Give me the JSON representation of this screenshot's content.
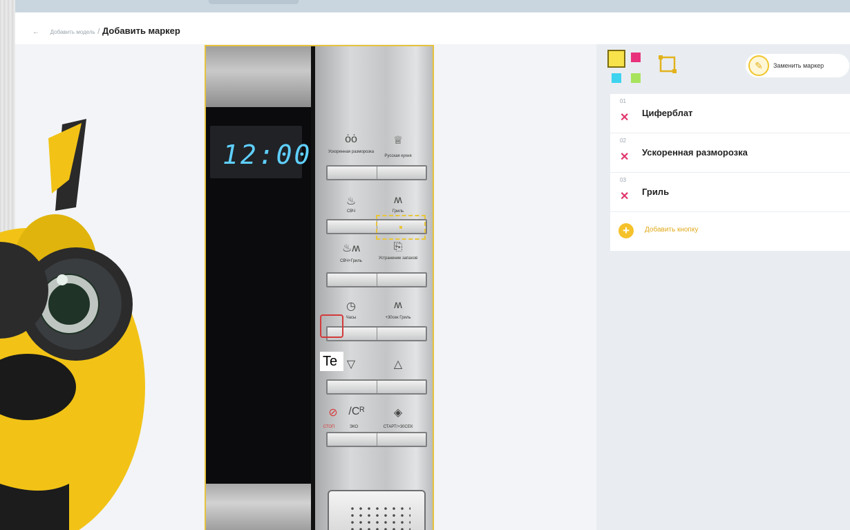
{
  "colors": {
    "accent": "#f5c22b",
    "delete": "#e0366b",
    "marker_selected": "#d33a3a"
  },
  "breadcrumb": {
    "parent": "Добавить модель",
    "separator": "/",
    "current": "Добавить маркер"
  },
  "device": {
    "display_time": "12:00",
    "panel_labels": {
      "defrost": "Ускоренная разморозка",
      "russian_cuisine": "Русская кухня",
      "microwave": "СВЧ",
      "grill": "Гриль",
      "combo": "СВЧ+Гриль",
      "odor": "Устранение запахов",
      "clock": "Часы",
      "plus30": "+30сек Гриль",
      "stop": "СТОП",
      "eco": "ЭКО",
      "start": "СТАРТ/+30СЕК"
    },
    "text_tool_preview": "Te"
  },
  "tools": {
    "palette": [
      "yellow",
      "pink",
      "cyan",
      "green"
    ],
    "crop_icon": "crop-icon",
    "replace_marker_label": "Заменить маркер",
    "replace_icon": "pencil-icon"
  },
  "markers": [
    {
      "num": "01",
      "name": "Циферблат"
    },
    {
      "num": "02",
      "name": "Ускоренная разморозка"
    },
    {
      "num": "03",
      "name": "Гриль"
    }
  ],
  "add_button_label": "Добавить кнопку"
}
